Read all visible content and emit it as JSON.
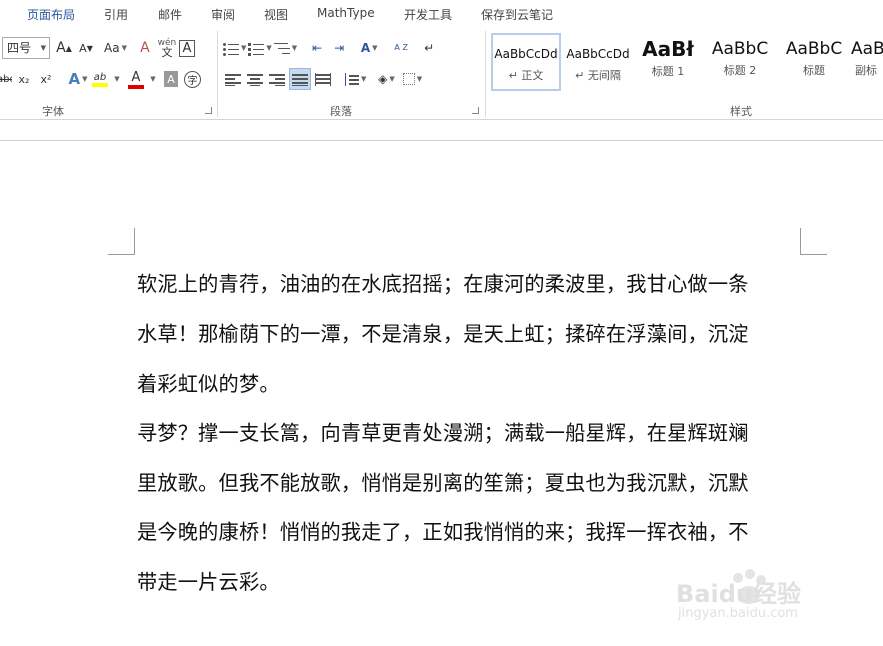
{
  "tabs": [
    {
      "label": "页面布局",
      "active": true
    },
    {
      "label": "引用",
      "active": false
    },
    {
      "label": "邮件",
      "active": false
    },
    {
      "label": "审阅",
      "active": false
    },
    {
      "label": "视图",
      "active": false
    },
    {
      "label": "MathType",
      "active": false
    },
    {
      "label": "开发工具",
      "active": false
    },
    {
      "label": "保存到云笔记",
      "active": false
    }
  ],
  "ribbon": {
    "font": {
      "size_value": "四号",
      "grow_label": "A",
      "shrink_label": "A",
      "change_case_label": "Aa",
      "phonetic_label": "wén\n文",
      "border_char_label": "A",
      "subscript_label": "x₂",
      "superscript_label": "x²",
      "strike_label": "abc",
      "effects_label": "A",
      "highlight_label": "ab",
      "font_color_label": "A",
      "shading_char_label": "A",
      "enclosed_char_label": "字",
      "group_label": "字体",
      "highlight_color": "#ffff00",
      "font_color": "#e00000"
    },
    "paragraph": {
      "group_label": "段落",
      "sort_label": "A Z"
    },
    "styles": {
      "group_label": "样式",
      "items": [
        {
          "preview": "AaBbCcDd",
          "name": "↵ 正文",
          "selected": true
        },
        {
          "preview": "AaBbCcDd",
          "name": "↵ 无间隔",
          "selected": false
        },
        {
          "preview": "AaBł",
          "name": "标题 1",
          "selected": false
        },
        {
          "preview": "AaBbC",
          "name": "标题 2",
          "selected": false
        },
        {
          "preview": "AaBbC",
          "name": "标题",
          "selected": false
        },
        {
          "preview": "AaB",
          "name": "副标",
          "selected": false
        }
      ]
    }
  },
  "document": {
    "lines": [
      "软泥上的青荇，油油的在水底招摇；在康河的柔波里，我甘心做一条",
      "水草！那榆荫下的一潭，不是清泉，是天上虹；揉碎在浮藻间，沉淀",
      "着彩虹似的梦。",
      "寻梦？撑一支长篙，向青草更青处漫溯；满载一船星辉，在星辉斑斓",
      "里放歌。但我不能放歌，悄悄是别离的笙箫；夏虫也为我沉默，沉默",
      "是今晚的康桥！悄悄的我走了，正如我悄悄的来；我挥一挥衣袖，不",
      "带走一片云彩。"
    ]
  },
  "watermark": {
    "brand": "Baidu经验",
    "url": "jingyan.baidu.com"
  },
  "colors": {
    "accent": "#2b579a",
    "selected_button_bg": "#c5d9f1"
  }
}
